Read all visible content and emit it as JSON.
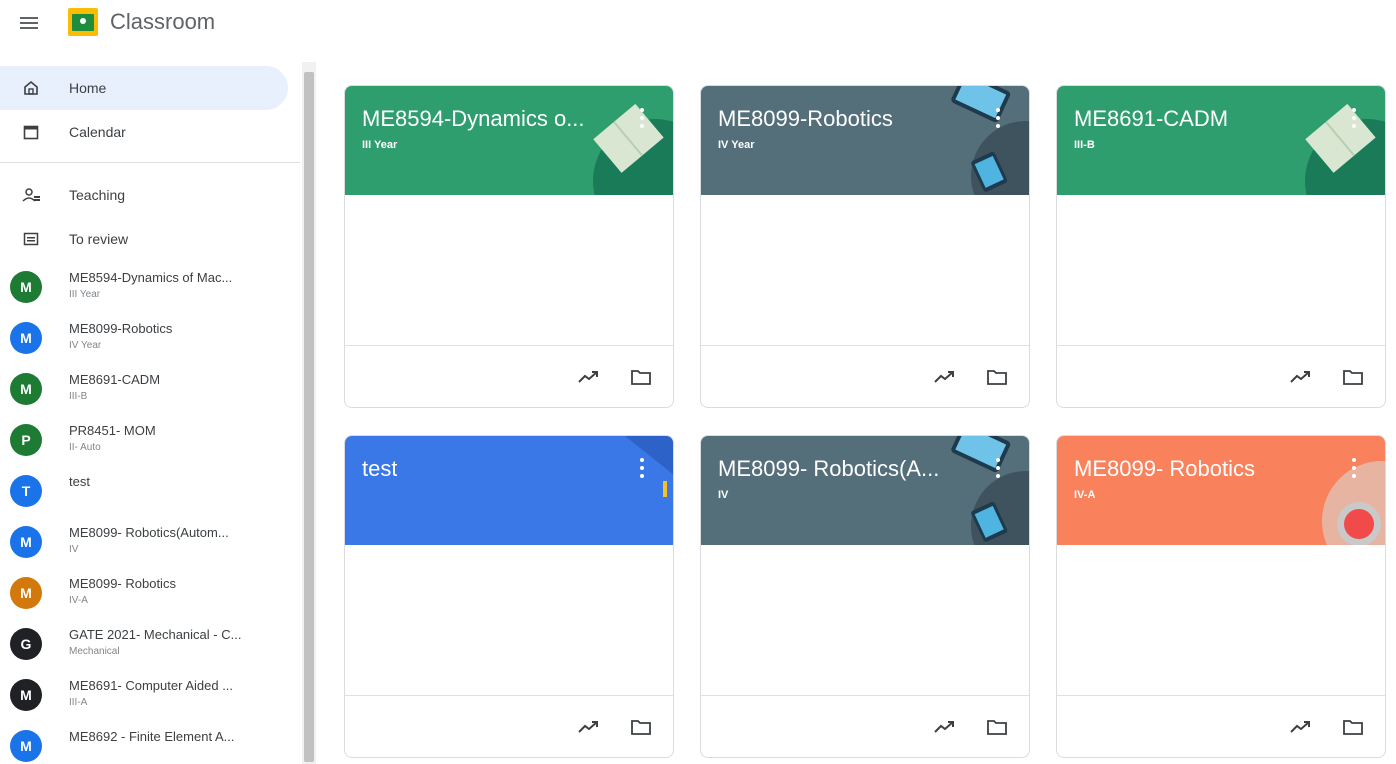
{
  "app": {
    "title": "Classroom"
  },
  "colors": {
    "green": "#2e9e6e",
    "slate": "#546e7a",
    "blue": "#3b78e7",
    "orange": "#f9825c"
  },
  "sidebar": {
    "nav": [
      {
        "label": "Home",
        "icon": "home-icon"
      },
      {
        "label": "Calendar",
        "icon": "calendar-icon"
      },
      {
        "label": "Teaching",
        "icon": "people-icon"
      },
      {
        "label": "To review",
        "icon": "assignment-icon"
      }
    ],
    "classes": [
      {
        "letter": "M",
        "color": "#1e7b34",
        "name": "ME8594-Dynamics of Mac...",
        "sub": "III Year"
      },
      {
        "letter": "M",
        "color": "#1a73e8",
        "name": "ME8099-Robotics",
        "sub": "IV Year"
      },
      {
        "letter": "M",
        "color": "#1e7b34",
        "name": "ME8691-CADM",
        "sub": "III-B"
      },
      {
        "letter": "P",
        "color": "#1e7b34",
        "name": "PR8451- MOM",
        "sub": "II- Auto"
      },
      {
        "letter": "T",
        "color": "#1a73e8",
        "name": "test",
        "sub": ""
      },
      {
        "letter": "M",
        "color": "#1a73e8",
        "name": "ME8099- Robotics(Autom...",
        "sub": "IV"
      },
      {
        "letter": "M",
        "color": "#d3780c",
        "name": "ME8099- Robotics",
        "sub": "IV-A"
      },
      {
        "letter": "G",
        "color": "#202124",
        "name": "GATE 2021- Mechanical - C...",
        "sub": "Mechanical"
      },
      {
        "letter": "M",
        "color": "#202124",
        "name": "ME8691- Computer Aided ...",
        "sub": "III-A"
      },
      {
        "letter": "M",
        "color": "#1a73e8",
        "name": "ME8692 - Finite Element A...",
        "sub": ""
      }
    ]
  },
  "cards": [
    {
      "title": "ME8594-Dynamics o...",
      "sub": "III Year"
    },
    {
      "title": "ME8099-Robotics",
      "sub": "IV Year"
    },
    {
      "title": "ME8691-CADM",
      "sub": "III-B"
    },
    {
      "title": "test",
      "sub": ""
    },
    {
      "title": "ME8099- Robotics(A...",
      "sub": "IV"
    },
    {
      "title": "ME8099- Robotics",
      "sub": "IV-A"
    }
  ]
}
